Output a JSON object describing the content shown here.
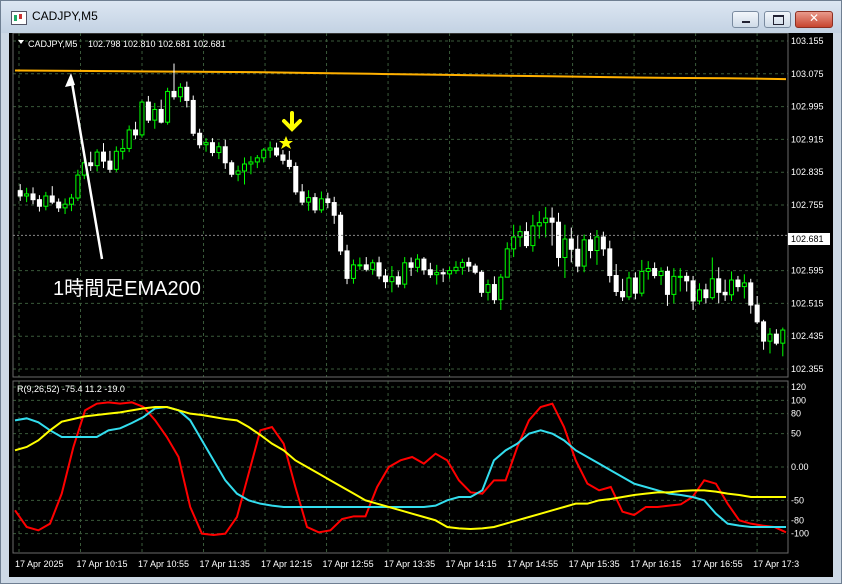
{
  "window": {
    "title": "CADJPY,M5",
    "buttons": {
      "minimize": "minimize",
      "maximize": "maximize",
      "close": "✕"
    }
  },
  "colors": {
    "background": "#000000",
    "grid": "#3a5a3a",
    "bull_candle": "#00ff00",
    "bear_candle": "#ffffff",
    "ema_line": "#ffb000",
    "osc_red": "#ff0000",
    "osc_cyan": "#33ddee",
    "osc_yellow": "#ffff00",
    "marker": "#ffff00"
  },
  "main_chart": {
    "symbol_label": "CADJPY,M5",
    "ohlc": "102.798 102.810 102.681 102.681",
    "current_price": "102.681",
    "annotation_text": "1時間足EMA200"
  },
  "oscillator": {
    "header": "R(9,26,52) -75.4 11.2 -19.0"
  },
  "chart_data": [
    {
      "type": "candlestick",
      "title": "CADJPY,M5",
      "y_axis_ticks": [
        103.155,
        103.075,
        102.995,
        102.915,
        102.835,
        102.755,
        102.595,
        102.515,
        102.435,
        102.355
      ],
      "ylim": [
        102.355,
        103.155
      ],
      "current_price": 102.681,
      "x_tick_labels": [
        "17 Apr 2025",
        "17 Apr 10:15",
        "17 Apr 10:55",
        "17 Apr 11:35",
        "17 Apr 12:15",
        "17 Apr 12:55",
        "17 Apr 13:35",
        "17 Apr 14:15",
        "17 Apr 14:55",
        "17 Apr 15:35",
        "17 Apr 16:15",
        "17 Apr 16:55",
        "17 Apr 17:3"
      ],
      "candles": [
        [
          102.79,
          102.806,
          102.765,
          102.777
        ],
        [
          102.777,
          102.797,
          102.762,
          102.782
        ],
        [
          102.782,
          102.798,
          102.757,
          102.768
        ],
        [
          102.768,
          102.779,
          102.739,
          102.752
        ],
        [
          102.752,
          102.787,
          102.742,
          102.777
        ],
        [
          102.777,
          102.801,
          102.757,
          102.762
        ],
        [
          102.762,
          102.771,
          102.738,
          102.748
        ],
        [
          102.748,
          102.771,
          102.733,
          102.757
        ],
        [
          102.757,
          102.782,
          102.74,
          102.772
        ],
        [
          102.772,
          102.841,
          102.765,
          102.828
        ],
        [
          102.828,
          102.871,
          102.818,
          102.858
        ],
        [
          102.858,
          102.885,
          102.838,
          102.851
        ],
        [
          102.851,
          102.891,
          102.837,
          102.884
        ],
        [
          102.884,
          102.906,
          102.845,
          102.862
        ],
        [
          102.862,
          102.887,
          102.834,
          102.842
        ],
        [
          102.842,
          102.898,
          102.836,
          102.886
        ],
        [
          102.886,
          102.915,
          102.866,
          102.893
        ],
        [
          102.893,
          102.949,
          102.884,
          102.938
        ],
        [
          102.938,
          102.958,
          102.916,
          102.926
        ],
        [
          102.926,
          103.01,
          102.92,
          103.006
        ],
        [
          103.006,
          103.021,
          102.955,
          102.962
        ],
        [
          102.962,
          103.004,
          102.941,
          102.988
        ],
        [
          102.988,
          103.012,
          102.954,
          102.957
        ],
        [
          102.957,
          103.041,
          102.951,
          103.032
        ],
        [
          103.032,
          103.1,
          103.012,
          103.019
        ],
        [
          103.019,
          103.052,
          103.006,
          103.042
        ],
        [
          103.042,
          103.056,
          102.993,
          103.01
        ],
        [
          103.01,
          103.022,
          102.923,
          102.93
        ],
        [
          102.93,
          102.941,
          102.893,
          102.902
        ],
        [
          102.902,
          102.918,
          102.885,
          102.907
        ],
        [
          102.907,
          102.918,
          102.874,
          102.883
        ],
        [
          102.883,
          102.908,
          102.867,
          102.897
        ],
        [
          102.897,
          102.914,
          102.843,
          102.858
        ],
        [
          102.858,
          102.864,
          102.823,
          102.83
        ],
        [
          102.83,
          102.851,
          102.813,
          102.838
        ],
        [
          102.838,
          102.871,
          102.805,
          102.855
        ],
        [
          102.855,
          102.874,
          102.83,
          102.86
        ],
        [
          102.86,
          102.877,
          102.845,
          102.87
        ],
        [
          102.87,
          102.894,
          102.859,
          102.889
        ],
        [
          102.889,
          102.91,
          102.87,
          102.894
        ],
        [
          102.894,
          102.907,
          102.872,
          102.877
        ],
        [
          102.877,
          102.889,
          102.854,
          102.864
        ],
        [
          102.864,
          102.887,
          102.842,
          102.849
        ],
        [
          102.849,
          102.859,
          102.78,
          102.787
        ],
        [
          102.787,
          102.806,
          102.755,
          102.762
        ],
        [
          102.762,
          102.791,
          102.741,
          102.773
        ],
        [
          102.773,
          102.784,
          102.735,
          102.743
        ],
        [
          102.743,
          102.788,
          102.736,
          102.77
        ],
        [
          102.77,
          102.785,
          102.747,
          102.761
        ],
        [
          102.761,
          102.775,
          102.709,
          102.73
        ],
        [
          102.73,
          102.738,
          102.633,
          102.643
        ],
        [
          102.643,
          102.658,
          102.562,
          102.576
        ],
        [
          102.576,
          102.622,
          102.563,
          102.609
        ],
        [
          102.609,
          102.627,
          102.597,
          102.609
        ],
        [
          102.609,
          102.628,
          102.593,
          102.598
        ],
        [
          102.598,
          102.622,
          102.585,
          102.614
        ],
        [
          102.614,
          102.629,
          102.574,
          102.582
        ],
        [
          102.582,
          102.599,
          102.552,
          102.568
        ],
        [
          102.568,
          102.606,
          102.542,
          102.58
        ],
        [
          102.58,
          102.593,
          102.554,
          102.562
        ],
        [
          102.562,
          102.628,
          102.552,
          102.614
        ],
        [
          102.614,
          102.627,
          102.582,
          102.603
        ],
        [
          102.603,
          102.635,
          102.591,
          102.623
        ],
        [
          102.623,
          102.628,
          102.585,
          102.597
        ],
        [
          102.597,
          102.614,
          102.577,
          102.585
        ],
        [
          102.585,
          102.609,
          102.561,
          102.59
        ],
        [
          102.59,
          102.6,
          102.567,
          102.587
        ],
        [
          102.587,
          102.605,
          102.575,
          102.595
        ],
        [
          102.595,
          102.618,
          102.587,
          102.603
        ],
        [
          102.603,
          102.624,
          102.585,
          102.615
        ],
        [
          102.615,
          102.627,
          102.592,
          102.606
        ],
        [
          102.606,
          102.612,
          102.586,
          102.591
        ],
        [
          102.591,
          102.596,
          102.531,
          102.542
        ],
        [
          102.542,
          102.573,
          102.522,
          102.561
        ],
        [
          102.561,
          102.581,
          102.514,
          102.524
        ],
        [
          102.524,
          102.587,
          102.499,
          102.579
        ],
        [
          102.579,
          102.664,
          102.579,
          102.648
        ],
        [
          102.648,
          102.707,
          102.628,
          102.677
        ],
        [
          102.677,
          102.705,
          102.653,
          102.69
        ],
        [
          102.69,
          102.713,
          102.65,
          102.656
        ],
        [
          102.656,
          102.731,
          102.641,
          102.704
        ],
        [
          102.704,
          102.74,
          102.673,
          102.712
        ],
        [
          102.712,
          102.75,
          102.676,
          102.723
        ],
        [
          102.723,
          102.749,
          102.656,
          102.713
        ],
        [
          102.713,
          102.736,
          102.605,
          102.627
        ],
        [
          102.627,
          102.707,
          102.577,
          102.672
        ],
        [
          102.672,
          102.7,
          102.615,
          102.647
        ],
        [
          102.647,
          102.682,
          102.591,
          102.606
        ],
        [
          102.606,
          102.683,
          102.591,
          102.67
        ],
        [
          102.67,
          102.687,
          102.625,
          102.644
        ],
        [
          102.644,
          102.694,
          102.609,
          102.677
        ],
        [
          102.677,
          102.69,
          102.631,
          102.648
        ],
        [
          102.648,
          102.668,
          102.566,
          102.583
        ],
        [
          102.583,
          102.611,
          102.533,
          102.544
        ],
        [
          102.544,
          102.575,
          102.521,
          102.531
        ],
        [
          102.531,
          102.592,
          102.523,
          102.577
        ],
        [
          102.577,
          102.591,
          102.525,
          102.54
        ],
        [
          102.54,
          102.621,
          102.532,
          102.593
        ],
        [
          102.593,
          102.618,
          102.573,
          102.6
        ],
        [
          102.6,
          102.615,
          102.576,
          102.583
        ],
        [
          102.583,
          102.603,
          102.56,
          102.593
        ],
        [
          102.593,
          102.605,
          102.509,
          102.537
        ],
        [
          102.537,
          102.601,
          102.515,
          102.581
        ],
        [
          102.581,
          102.601,
          102.544,
          102.581
        ],
        [
          102.581,
          102.591,
          102.544,
          102.57
        ],
        [
          102.57,
          102.582,
          102.499,
          102.521
        ],
        [
          102.521,
          102.564,
          102.512,
          102.548
        ],
        [
          102.548,
          102.563,
          102.515,
          102.529
        ],
        [
          102.529,
          102.627,
          102.524,
          102.575
        ],
        [
          102.575,
          102.603,
          102.515,
          102.542
        ],
        [
          102.542,
          102.573,
          102.521,
          102.536
        ],
        [
          102.536,
          102.593,
          102.521,
          102.572
        ],
        [
          102.572,
          102.582,
          102.544,
          102.556
        ],
        [
          102.556,
          102.586,
          102.527,
          102.565
        ],
        [
          102.565,
          102.575,
          102.49,
          102.511
        ],
        [
          102.511,
          102.533,
          102.465,
          102.47
        ],
        [
          102.47,
          102.475,
          102.402,
          102.423
        ],
        [
          102.423,
          102.455,
          102.393,
          102.44
        ],
        [
          102.44,
          102.452,
          102.413,
          102.418
        ],
        [
          102.418,
          102.456,
          102.386,
          102.45
        ]
      ],
      "ema_series": [
        {
          "name": "1時間足EMA200",
          "values": [
            103.083,
            103.082,
            103.081,
            103.08,
            103.079,
            103.077,
            103.075,
            103.073,
            103.071,
            103.069,
            103.067,
            103.065,
            103.064,
            103.062
          ]
        }
      ],
      "signal_candle_index": 40
    },
    {
      "type": "line",
      "title": "R(9,26,52) -75.4 11.2 -19.0",
      "ylim": [
        -120,
        120
      ],
      "y_axis_ticks": [
        120,
        100,
        80,
        50,
        0,
        -50,
        -80,
        -100
      ],
      "series": [
        {
          "values": [
            -65,
            -90,
            -95,
            -85,
            -40,
            30,
            85,
            95,
            97,
            95,
            97,
            90,
            70,
            45,
            15,
            -60,
            -100,
            -102,
            -100,
            -75,
            -10,
            55,
            60,
            35,
            -30,
            -90,
            -98,
            -95,
            -78,
            -74,
            -74,
            -30,
            0,
            10,
            15,
            5,
            20,
            10,
            -20,
            -38,
            -40,
            -20,
            -20,
            30,
            70,
            90,
            95,
            60,
            10,
            -25,
            -35,
            -30,
            -67,
            -72,
            -60,
            -60,
            -58,
            -56,
            -45,
            -20,
            -25,
            -55,
            -80,
            -85,
            -88,
            -90,
            -98
          ]
        },
        {
          "values": [
            70,
            73,
            67,
            55,
            45,
            45,
            45,
            45,
            55,
            58,
            66,
            75,
            88,
            90,
            85,
            70,
            40,
            10,
            -20,
            -40,
            -50,
            -55,
            -58,
            -60,
            -60,
            -60,
            -60,
            -60,
            -60,
            -60,
            -60,
            -60,
            -60,
            -60,
            -60,
            -60,
            -58,
            -50,
            -45,
            -45,
            -35,
            10,
            25,
            35,
            50,
            55,
            50,
            40,
            25,
            15,
            5,
            -5,
            -15,
            -25,
            -30,
            -35,
            -40,
            -42,
            -45,
            -50,
            -70,
            -85,
            -88,
            -90,
            -90,
            -90,
            -90
          ]
        },
        {
          "values": [
            25,
            30,
            40,
            55,
            68,
            72,
            76,
            78,
            80,
            82,
            85,
            88,
            90,
            90,
            85,
            80,
            78,
            75,
            72,
            70,
            60,
            48,
            35,
            25,
            10,
            0,
            -10,
            -20,
            -30,
            -40,
            -50,
            -55,
            -60,
            -65,
            -70,
            -75,
            -80,
            -90,
            -92,
            -93,
            -92,
            -90,
            -85,
            -80,
            -75,
            -70,
            -65,
            -60,
            -55,
            -55,
            -50,
            -48,
            -45,
            -42,
            -40,
            -38,
            -38,
            -36,
            -35,
            -35,
            -37,
            -40,
            -42,
            -45,
            -45,
            -45,
            -45
          ]
        }
      ]
    }
  ]
}
